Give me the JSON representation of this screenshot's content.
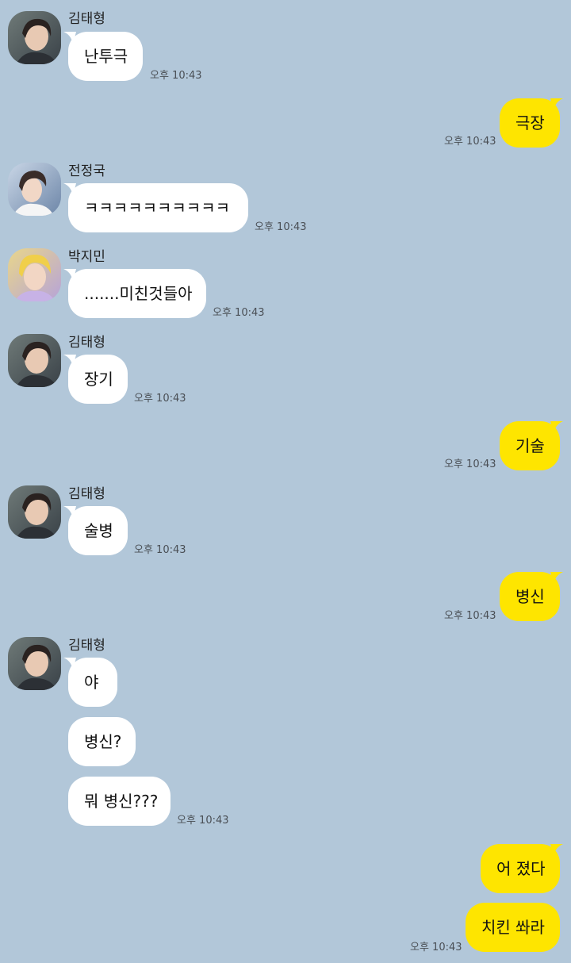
{
  "colors": {
    "background": "#b2c7d9",
    "incoming_bubble": "#ffffff",
    "outgoing_bubble": "#fee500",
    "time_text": "#4a4f55"
  },
  "messages": [
    {
      "sender": "김태형",
      "avatar": "profile-photo-taehyung",
      "text": "난투극",
      "time": "오후 10:43"
    },
    {
      "text": "극장",
      "time": "오후 10:43"
    },
    {
      "sender": "전정국",
      "avatar": "profile-photo-jungkook",
      "text": "ㅋㅋㅋㅋㅋㅋㅋㅋㅋㅋ",
      "time": "오후 10:43"
    },
    {
      "sender": "박지민",
      "avatar": "profile-photo-jimin",
      "text": ".......미친것들아",
      "time": "오후 10:43"
    },
    {
      "sender": "김태형",
      "avatar": "profile-photo-taehyung",
      "text": "장기",
      "time": "오후 10:43"
    },
    {
      "text": "기술",
      "time": "오후 10:43"
    },
    {
      "sender": "김태형",
      "avatar": "profile-photo-taehyung",
      "text": "술병",
      "time": "오후 10:43"
    },
    {
      "text": "병신",
      "time": "오후 10:43"
    },
    {
      "sender": "김태형",
      "avatar": "profile-photo-taehyung",
      "text": "야"
    },
    {
      "text": "병신?"
    },
    {
      "text": "뭐 병신???",
      "time": "오후 10:43"
    },
    {
      "text": "어 졌다"
    },
    {
      "text": "치킨 쏴라",
      "time": "오후 10:43"
    }
  ]
}
